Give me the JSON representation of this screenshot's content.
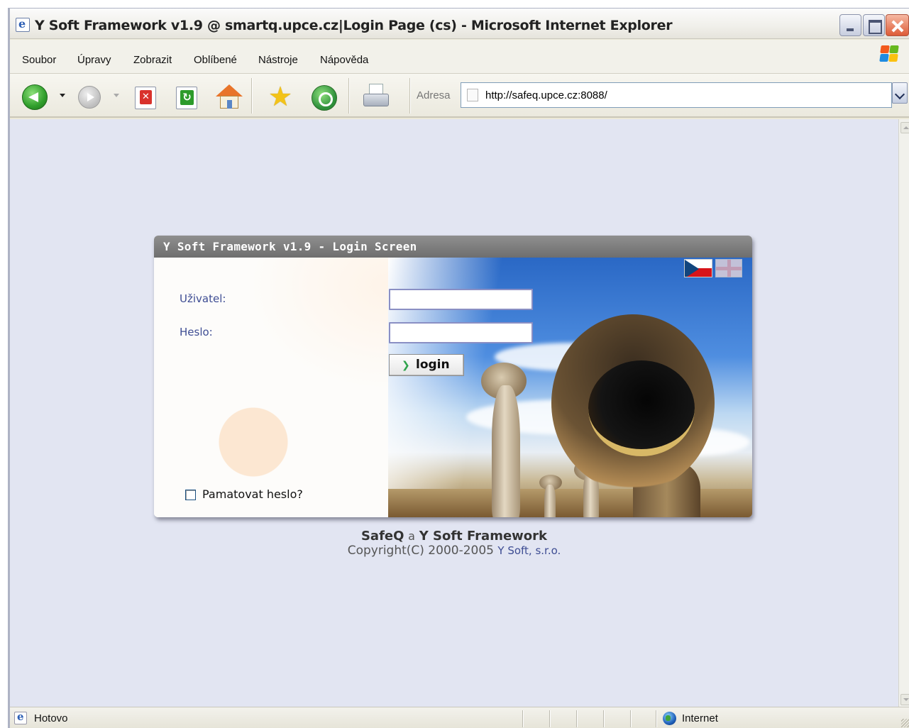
{
  "window": {
    "title": "Y Soft Framework v1.9 @ smartq.upce.cz|Login Page (cs) - Microsoft Internet Explorer"
  },
  "menu": {
    "items": [
      "Soubor",
      "Úpravy",
      "Zobrazit",
      "Oblíbené",
      "Nástroje",
      "Nápověda"
    ]
  },
  "toolbar": {
    "address_label": "Adresa",
    "address_value": "http://safeq.upce.cz:8088/"
  },
  "login_panel": {
    "title": "Y Soft Framework v1.9 - Login Screen",
    "username_label": "Uživatel:",
    "username_value": "",
    "password_label": "Heslo:",
    "password_value": "",
    "login_button": "login",
    "remember_label": "Pamatovat heslo?",
    "remember_checked": false,
    "languages": [
      "cz-flag-icon",
      "uk-flag-icon"
    ]
  },
  "footer": {
    "product": "SafeQ",
    "conjunction": "a",
    "framework": "Y Soft Framework",
    "copyright": "Copyright(C) 2000-2005",
    "company": "Y Soft, s.r.o."
  },
  "status": {
    "text": "Hotovo",
    "zone": "Internet"
  }
}
